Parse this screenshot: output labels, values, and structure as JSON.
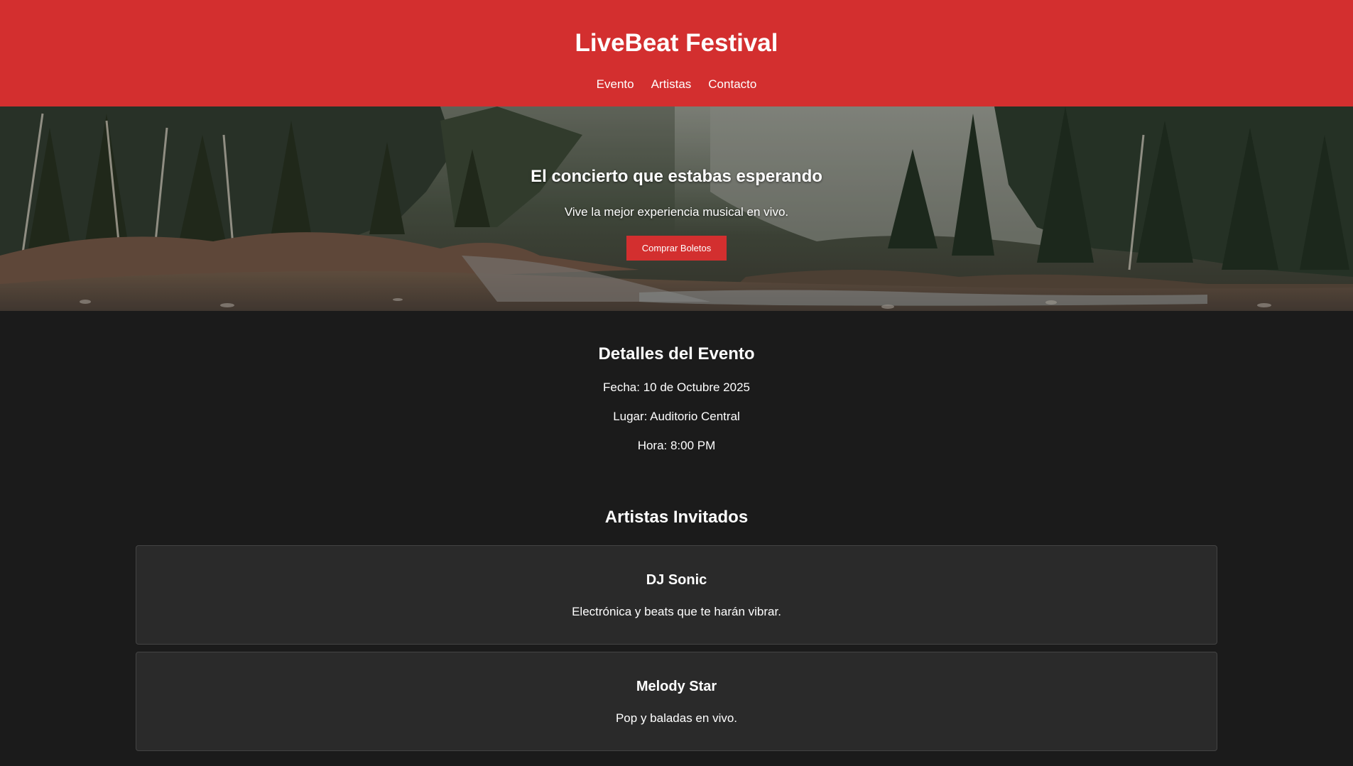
{
  "header": {
    "title": "LiveBeat Festival",
    "nav": [
      {
        "label": "Evento"
      },
      {
        "label": "Artistas"
      },
      {
        "label": "Contacto"
      }
    ]
  },
  "hero": {
    "title": "El concierto que estabas esperando",
    "subtitle": "Vive la mejor experiencia musical en vivo.",
    "button_label": "Comprar Boletos"
  },
  "details": {
    "title": "Detalles del Evento",
    "date": "Fecha: 10 de Octubre 2025",
    "place": "Lugar: Auditorio Central",
    "time": "Hora: 8:00 PM"
  },
  "artists": {
    "title": "Artistas Invitados",
    "items": [
      {
        "name": "DJ Sonic",
        "description": "Electrónica y beats que te harán vibrar."
      },
      {
        "name": "Melody Star",
        "description": "Pop y baladas en vivo."
      }
    ]
  },
  "colors": {
    "brand_red": "#d32f2f",
    "page_background": "#1b1b1b",
    "card_background": "#2a2a2a"
  }
}
